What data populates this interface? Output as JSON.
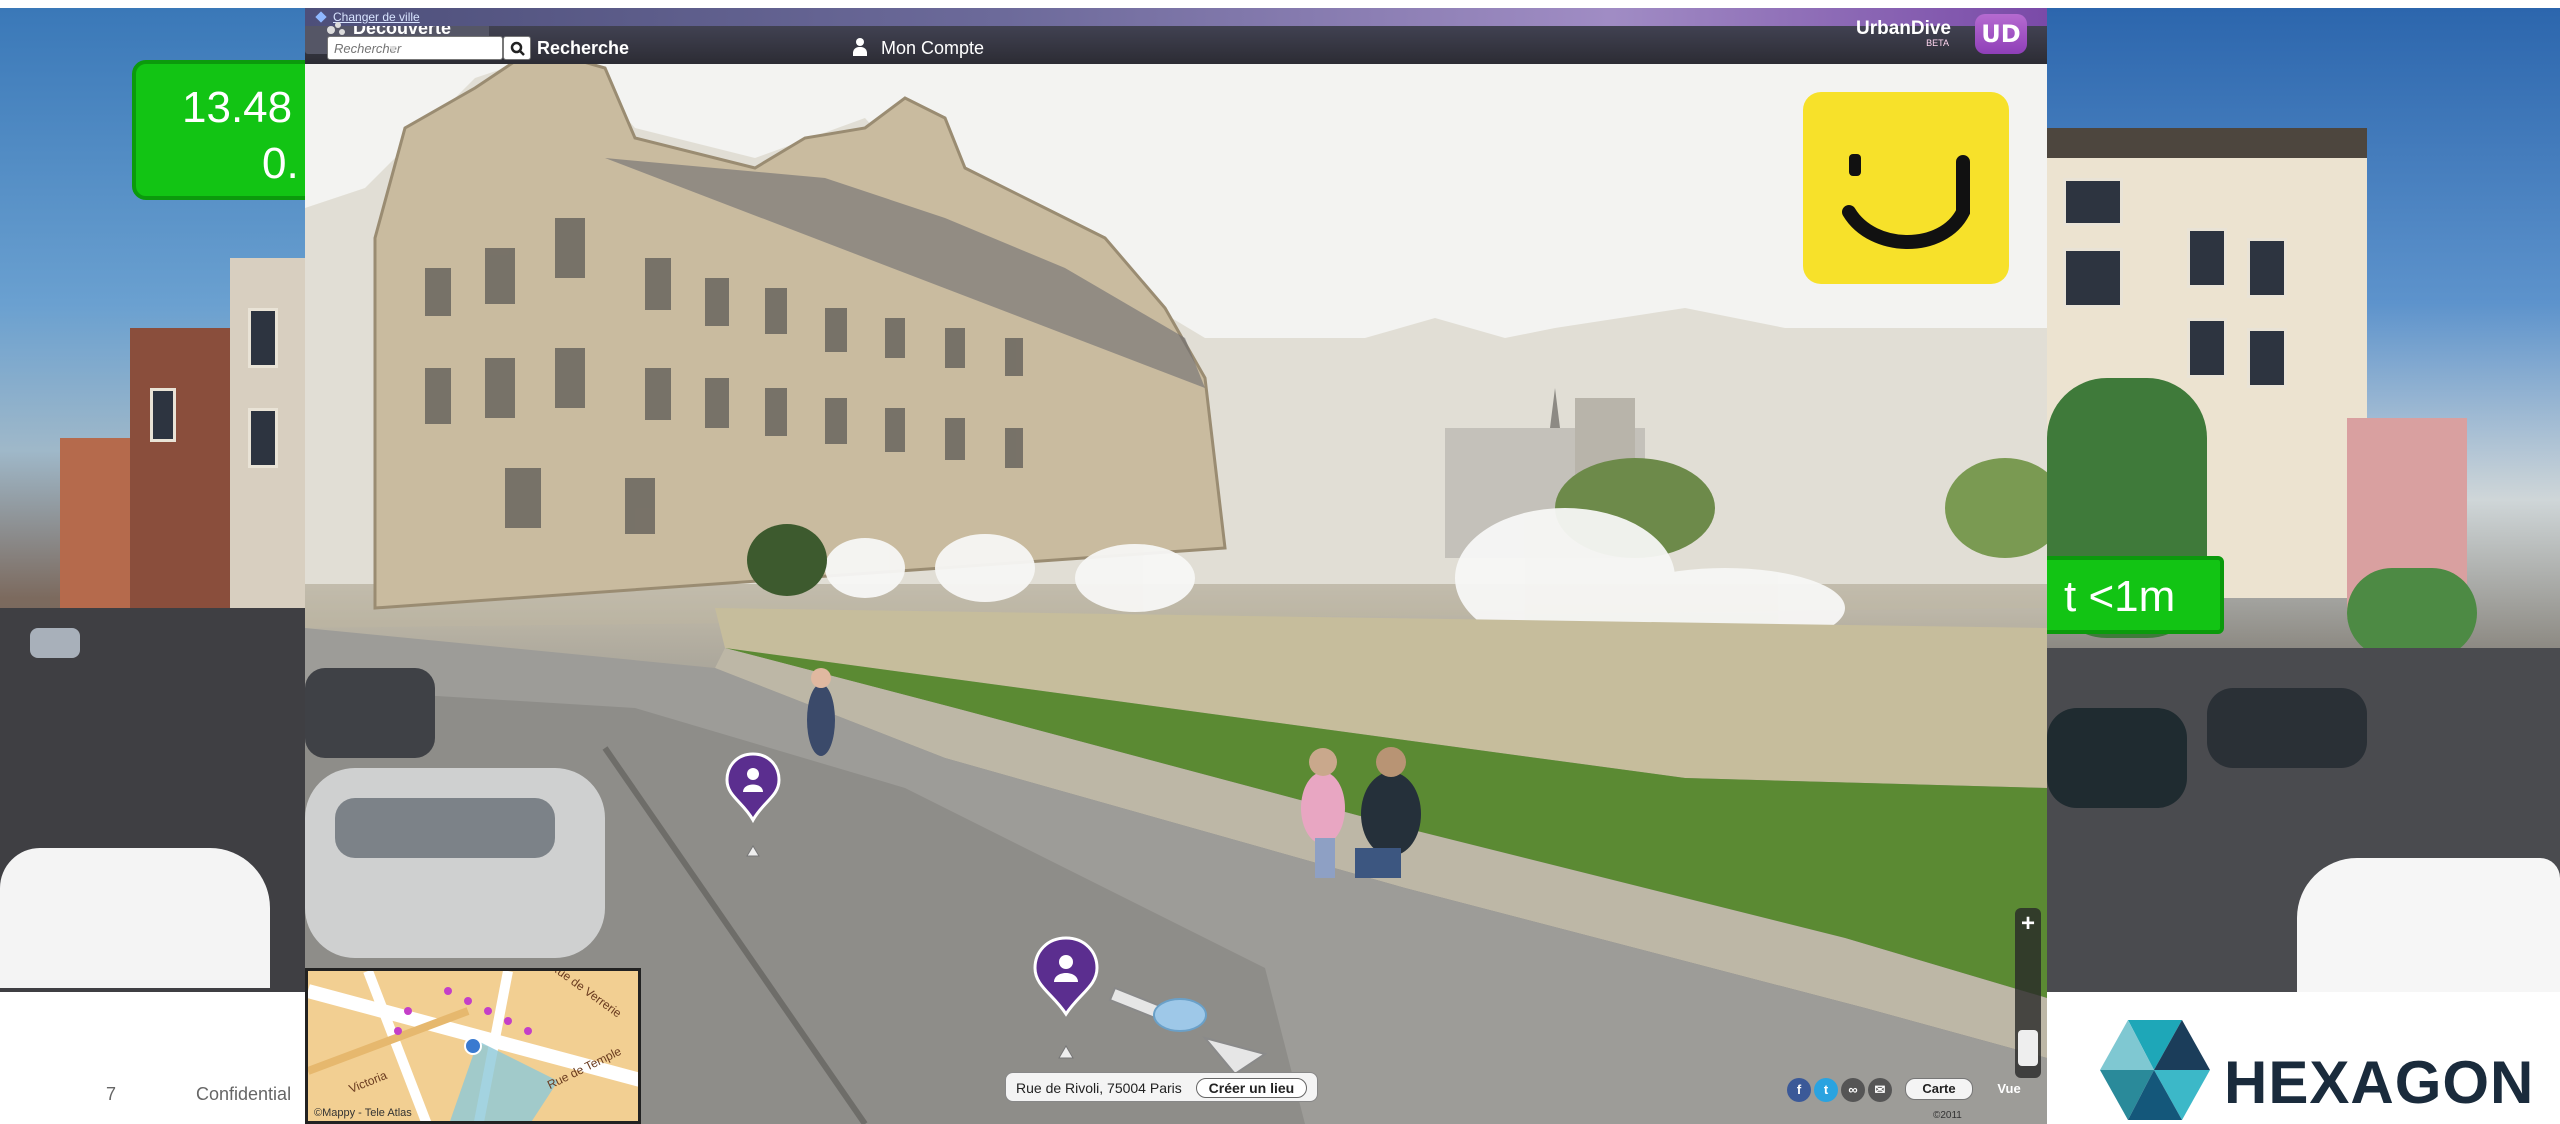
{
  "slide": {
    "page_number": "7",
    "confidential": "Confidential",
    "brand_logo": "HEXAGON"
  },
  "badges": {
    "left_line1": "13.48",
    "left_line2": "0.",
    "right": "t <1m"
  },
  "viewer": {
    "change_city": "Changer de ville",
    "search_placeholder": "Rechercher",
    "nav": {
      "recherche": "Recherche",
      "decouverte": "Découverte",
      "compte": "Mon Compte"
    },
    "brand": "UrbanDive",
    "brand_beta": "BETA",
    "brand_mark": "UD",
    "address": "Rue de Rivoli, 75004 Paris",
    "create_place": "Créer un lieu",
    "carte": "Carte",
    "vue": "Vue",
    "copyright": "©2011",
    "minimap_credit": "©Mappy - Tele Atlas",
    "minimap_streets": [
      "Rue de Verrerie",
      "Rue de Temple",
      "Victoria"
    ]
  },
  "colors": {
    "badge_green": "#12c414",
    "smiley_yellow": "#f7e12a",
    "poi_purple": "#5b2e8f",
    "hexagon_dark": "#1a2b3c",
    "hexagon_teal": "#1ea7b8"
  },
  "icons": [
    "search-icon",
    "discover-icon",
    "account-icon",
    "poi-marker-icon",
    "smiley-icon",
    "facebook-icon",
    "twitter-icon",
    "link-icon",
    "mail-icon",
    "hexagon-logo-icon"
  ]
}
